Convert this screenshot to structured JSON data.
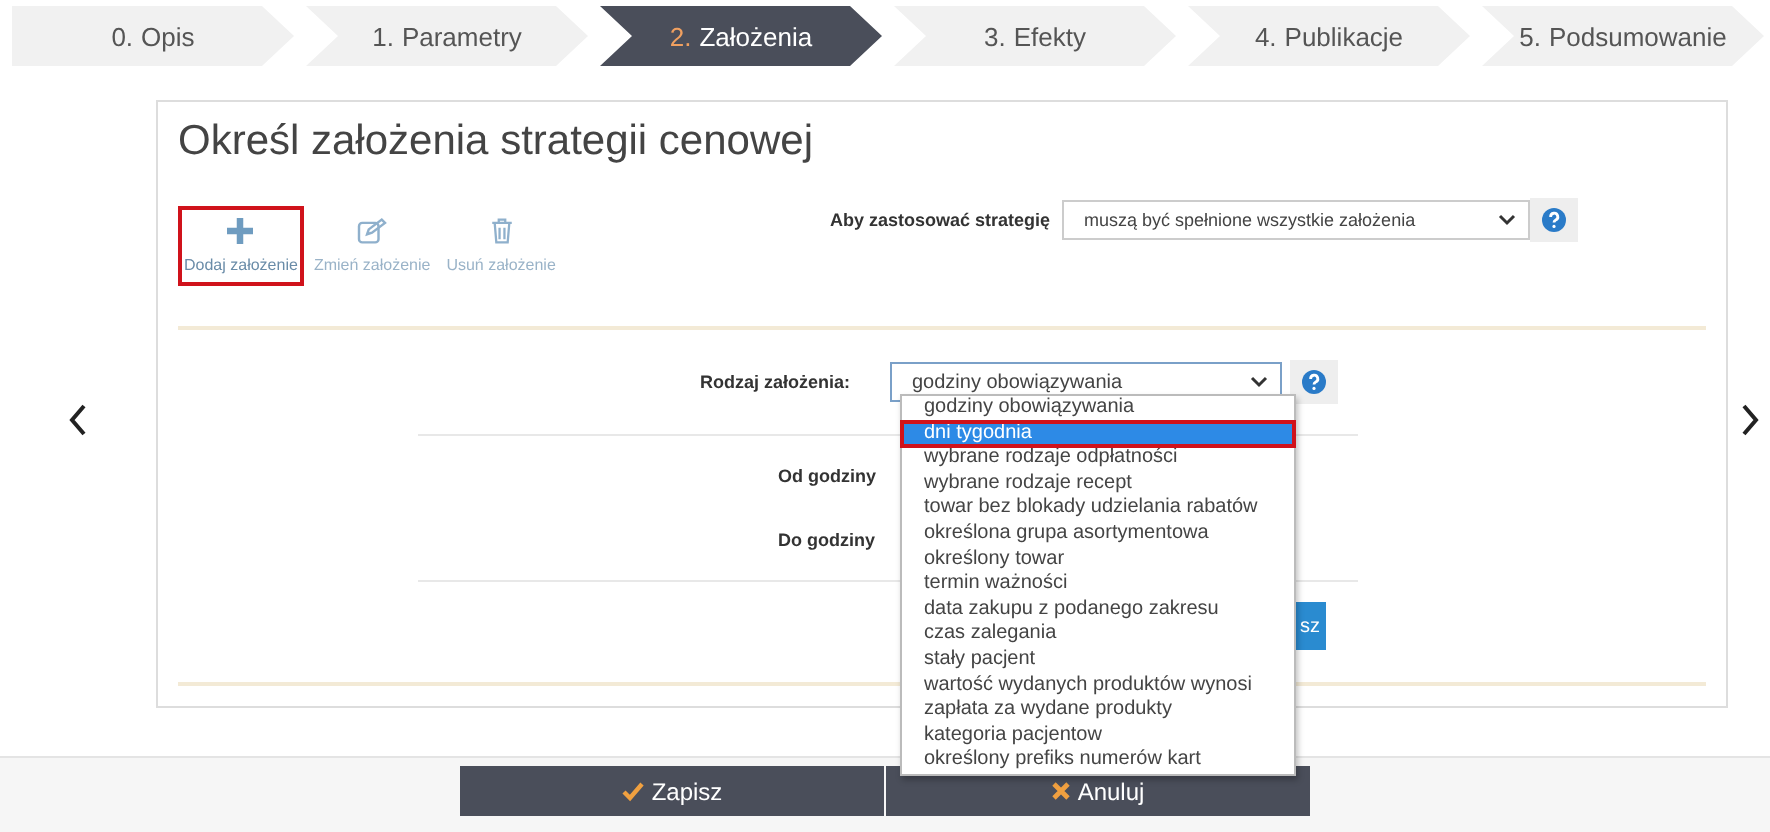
{
  "steps": [
    {
      "number": "0.",
      "label": "Opis",
      "selected": false
    },
    {
      "number": "1.",
      "label": "Parametry",
      "selected": false
    },
    {
      "number": "2.",
      "label": "Założenia",
      "selected": true
    },
    {
      "number": "3.",
      "label": "Efekty",
      "selected": false
    },
    {
      "number": "4.",
      "label": "Publikacje",
      "selected": false
    },
    {
      "number": "5.",
      "label": "Podsumowanie",
      "selected": false
    }
  ],
  "title": "Określ założenia strategii cenowej",
  "actions": [
    {
      "kind": "add",
      "label": "Dodaj założenie",
      "disabled": false,
      "highlighted": true
    },
    {
      "kind": "edit",
      "label": "Zmień założenie",
      "disabled": true,
      "highlighted": false
    },
    {
      "kind": "delete",
      "label": "Usuń założenie",
      "disabled": true,
      "highlighted": false
    }
  ],
  "strategy": {
    "label": "Aby zastosować strategię",
    "value": "muszą być spełnione wszystkie założenia"
  },
  "type": {
    "label": "Rodzaj założenia:",
    "value": "godziny obowiązywania",
    "options": [
      {
        "label": "godziny obowiązywania",
        "hovered": false,
        "highlighted": false
      },
      {
        "label": "dni tygodnia",
        "hovered": true,
        "highlighted": true
      },
      {
        "label": "wybrane rodzaje odpłatności",
        "hovered": false,
        "highlighted": false
      },
      {
        "label": "wybrane rodzaje recept",
        "hovered": false,
        "highlighted": false
      },
      {
        "label": "towar bez blokady udzielania rabatów",
        "hovered": false,
        "highlighted": false
      },
      {
        "label": "określona grupa asortymentowa",
        "hovered": false,
        "highlighted": false
      },
      {
        "label": "określony towar",
        "hovered": false,
        "highlighted": false
      },
      {
        "label": "termin ważności",
        "hovered": false,
        "highlighted": false
      },
      {
        "label": "data zakupu z podanego zakresu",
        "hovered": false,
        "highlighted": false
      },
      {
        "label": "czas zalegania",
        "hovered": false,
        "highlighted": false
      },
      {
        "label": "stały pacjent",
        "hovered": false,
        "highlighted": false
      },
      {
        "label": "wartość wydanych produktów wynosi",
        "hovered": false,
        "highlighted": false
      },
      {
        "label": "zapłata za wydane produkty",
        "hovered": false,
        "highlighted": false
      },
      {
        "label": "kategoria pacjentow",
        "hovered": false,
        "highlighted": false
      },
      {
        "label": "określony prefiks numerów kart",
        "hovered": false,
        "highlighted": false
      }
    ]
  },
  "fields": [
    {
      "label": "Od godziny"
    },
    {
      "label": "Do godziny"
    }
  ],
  "inner_button": "sz",
  "footer_buttons": [
    {
      "kind": "save",
      "label": "Zapisz"
    },
    {
      "kind": "cancel",
      "label": "Anuluj"
    }
  ]
}
